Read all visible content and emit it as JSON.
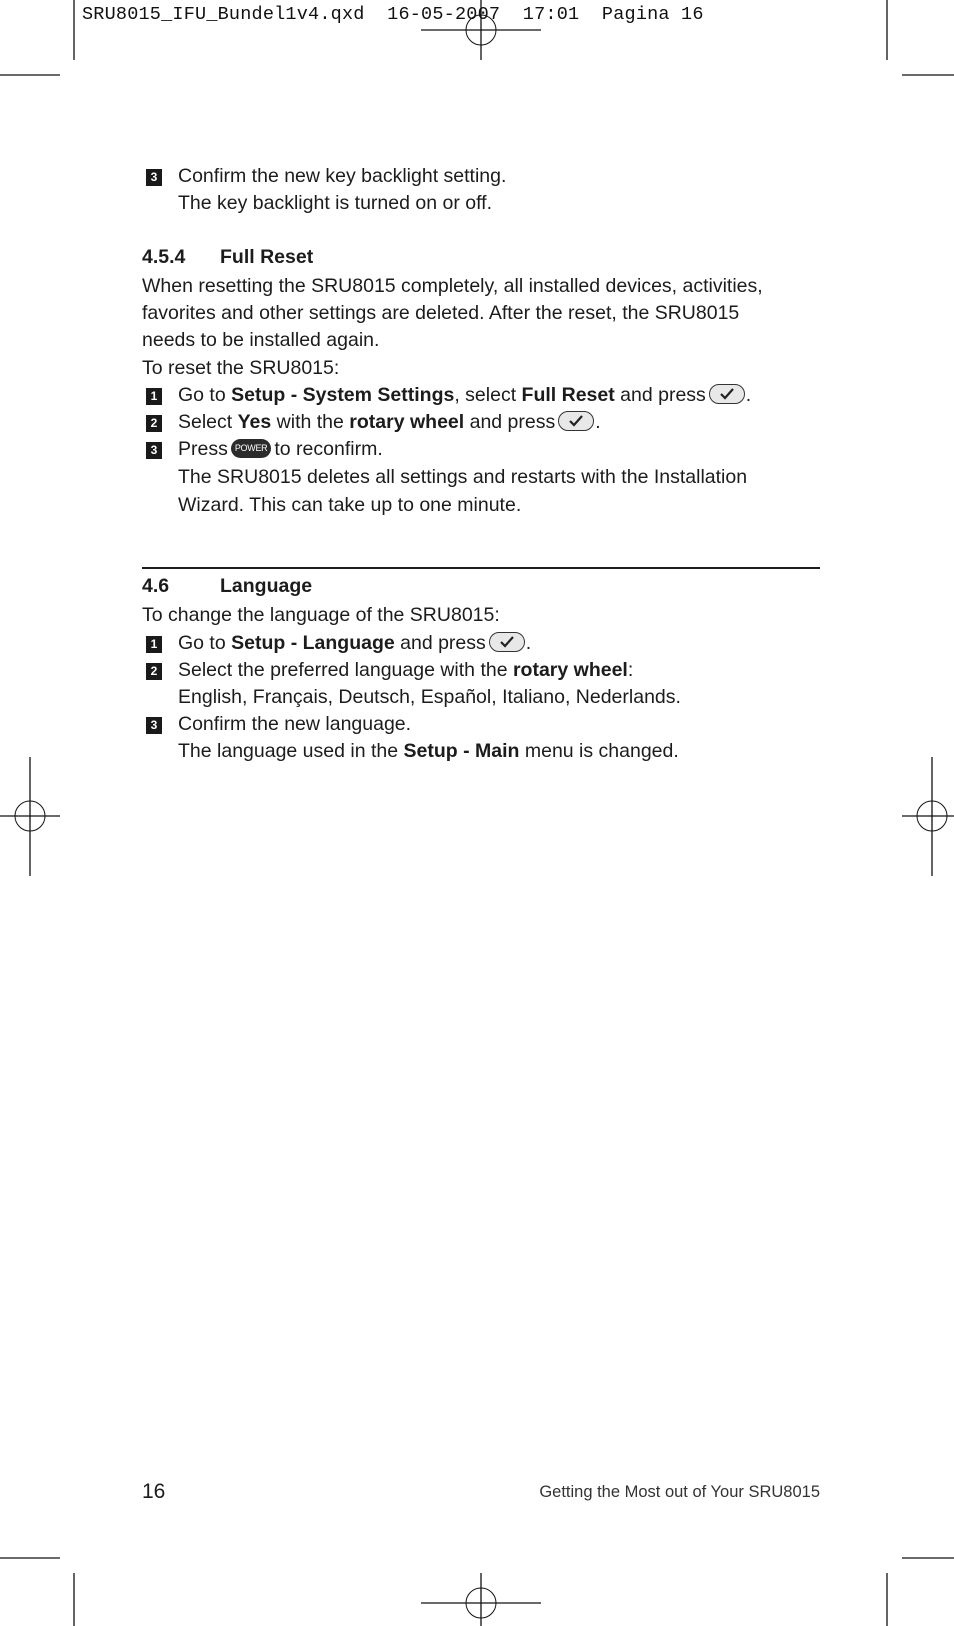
{
  "slug": {
    "filename": "SRU8015_IFU_Bundel1v4.qxd",
    "date": "16-05-2007",
    "time": "17:01",
    "page_label": "Pagina 16"
  },
  "prev_section": {
    "step3": {
      "number": "3",
      "text": "Confirm the new key backlight setting.",
      "result": "The key backlight is turned on or off."
    }
  },
  "full_reset": {
    "number": "4.5.4",
    "title": "Full Reset",
    "intro_lines": [
      "When resetting the SRU8015 completely, all installed devices, activities,",
      "favorites and other settings are deleted. After the reset, the SRU8015",
      "needs to be installed again."
    ],
    "lead": "To reset the SRU8015:",
    "steps": [
      {
        "number": "1",
        "p1": "Go to ",
        "b1": "Setup - System Settings",
        "p2": ", select ",
        "b2": "Full Reset",
        "p3": " and press",
        "icon": "ok-button",
        "p4": "."
      },
      {
        "number": "2",
        "p1": "Select ",
        "b1": "Yes",
        "p2": " with the ",
        "b2": "rotary wheel",
        "p3": " and press",
        "icon": "ok-button",
        "p4": "."
      },
      {
        "number": "3",
        "p1": "Press",
        "icon": "power-button",
        "icon_label": "POWER",
        "p2": "to reconfirm.",
        "result_lines": [
          "The SRU8015 deletes all settings and restarts with the Installation",
          "Wizard. This can take up to one minute."
        ]
      }
    ]
  },
  "language": {
    "number": "4.6",
    "title": "Language",
    "lead": "To change the language of the SRU8015:",
    "steps": [
      {
        "number": "1",
        "p1": "Go to ",
        "b1": "Setup - Language",
        "p2": " and press",
        "icon": "ok-button",
        "p3": "."
      },
      {
        "number": "2",
        "p1": "Select the preferred language with the ",
        "b1": "rotary wheel",
        "p2": ":",
        "languages": "English, Français, Deutsch, Español, Italiano, Nederlands."
      },
      {
        "number": "3",
        "text": "Confirm the new language.",
        "r1": "The language used in the ",
        "rb": "Setup - Main",
        "r2": " menu is changed."
      }
    ]
  },
  "footer": {
    "page_number": "16",
    "running_title": "Getting the Most out of Your SRU8015"
  }
}
